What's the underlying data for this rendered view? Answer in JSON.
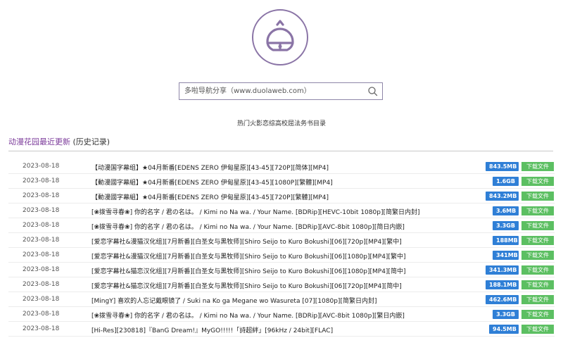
{
  "logo": {
    "icon": "bell-icon",
    "color": "#8a74a6"
  },
  "search": {
    "placeholder": "多啦导航分享（www.duolaweb.com）",
    "icon": "search-icon"
  },
  "hot_links": "热门火影恋综高校屈法务书目录",
  "section": {
    "title": "动漫花园最近更新",
    "history": "(历史记录)"
  },
  "colors": {
    "size_badge": "#2f7fd6",
    "download_button": "#5cbf62",
    "accent": "#7b3a9a"
  },
  "rows": [
    {
      "date": "2023-08-18",
      "title": "【动漫国字幕组】★04月新番[EDENS ZERO 伊甸星原][43-45][720P][简体][MP4]",
      "size": "843.5MB",
      "download": "下载文件"
    },
    {
      "date": "2023-08-18",
      "title": "【動漫國字幕組】★04月新番[EDENS ZERO 伊甸星原][43-45][1080P][繁體][MP4]",
      "size": "1.6GB",
      "download": "下载文件"
    },
    {
      "date": "2023-08-18",
      "title": "【動漫國字幕組】★04月新番[EDENS ZERO 伊甸星原][43-45][720P][繁體][MP4]",
      "size": "843.2MB",
      "download": "下载文件"
    },
    {
      "date": "2023-08-18",
      "title": "[❀拨雪寻春❀] 你的名字 / 君の名は。 / Kimi no Na wa. / Your Name. [BDRip][HEVC-10bit 1080p][简繁日内封]",
      "size": "3.6MB",
      "download": "下载文件"
    },
    {
      "date": "2023-08-18",
      "title": "[❀拨雪寻春❀] 你的名字 / 君の名は。 / Kimi no Na wa. / Your Name. [BDRip][AVC-8bit 1080p][简日内嵌]",
      "size": "3.3GB",
      "download": "下载文件"
    },
    {
      "date": "2023-08-18",
      "title": "[爱恋字幕社&漫猫汉化组][7月新番][白圣女与黑牧师][Shiro Seijo to Kuro Bokushi][06][720p][MP4][繁中]",
      "size": "188MB",
      "download": "下载文件"
    },
    {
      "date": "2023-08-18",
      "title": "[爱恋字幕社&漫猫汉化组][7月新番][白圣女与黑牧师][Shiro Seijo to Kuro Bokushi][06][1080p][MP4][繁中]",
      "size": "341MB",
      "download": "下载文件"
    },
    {
      "date": "2023-08-18",
      "title": "[爱恋字幕社&猫恋汉化组][7月新番][白圣女与黑牧师][Shiro Seijo to Kuro Bokushi][06][1080p][MP4][简中]",
      "size": "341.3MB",
      "download": "下载文件"
    },
    {
      "date": "2023-08-18",
      "title": "[爱恋字幕社&猫恋汉化组][7月新番][白圣女与黑牧师][Shiro Seijo to Kuro Bokushi][06][720p][MP4][简中]",
      "size": "188.1MB",
      "download": "下载文件"
    },
    {
      "date": "2023-08-18",
      "title": "[MingY] 喜欢的人忘记戴眼镜了 / Suki na Ko ga Megane wo Wasureta [07][1080p][简繁日内封]",
      "size": "462.6MB",
      "download": "下载文件"
    },
    {
      "date": "2023-08-18",
      "title": "[❀拨雪寻春❀] 你的名字 / 君の名は。 / Kimi no Na wa. / Your Name. [BDRip][AVC-8bit 1080p][繁日内嵌]",
      "size": "3.3GB",
      "download": "下载文件"
    },
    {
      "date": "2023-08-18",
      "title": "[Hi-Res][230818]『BanG Dream!』MyGO!!!!!「詩超絆」[96kHz / 24bit][FLAC]",
      "size": "94.5MB",
      "download": "下载文件"
    }
  ]
}
